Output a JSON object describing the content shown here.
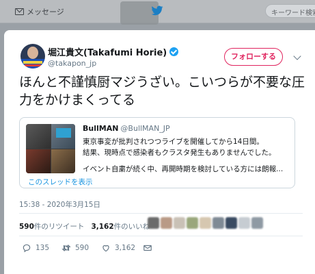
{
  "topbar": {
    "prefix": "",
    "messages_label": "メッセージ",
    "search_placeholder": "キーワード検索"
  },
  "tweet": {
    "display_name": "堀江貴文(Takafumi Horie)",
    "handle": "@takapon_jp",
    "follow_label": "フォローする",
    "text": "ほんと不謹慎厨マジうざい。こいつらが不要な圧力をかけまくってる",
    "timestamp": "15:38 - 2020年3月15日",
    "retweets_count": "590",
    "retweets_label": "件のリツイート",
    "likes_count": "3,162",
    "likes_label": "件のいいね",
    "actions": {
      "reply_count": "135",
      "retweet_count": "590",
      "like_count": "3,162"
    }
  },
  "quote": {
    "name": "BullMAN",
    "handle": "@BullMAN_JP",
    "line1": "東京事変が批判されつつライブを開催してから14日間。",
    "line2": "結果、現時点で感染者もクラスタ発生もありませんでした。",
    "line3": "イベント自粛が続く中、再開時期を検討している方には朗報...",
    "thread_link": "このスレッドを表示"
  },
  "colors": {
    "accent": "#1da1f2",
    "follow": "#e0245e",
    "secondary_text": "#657786"
  }
}
